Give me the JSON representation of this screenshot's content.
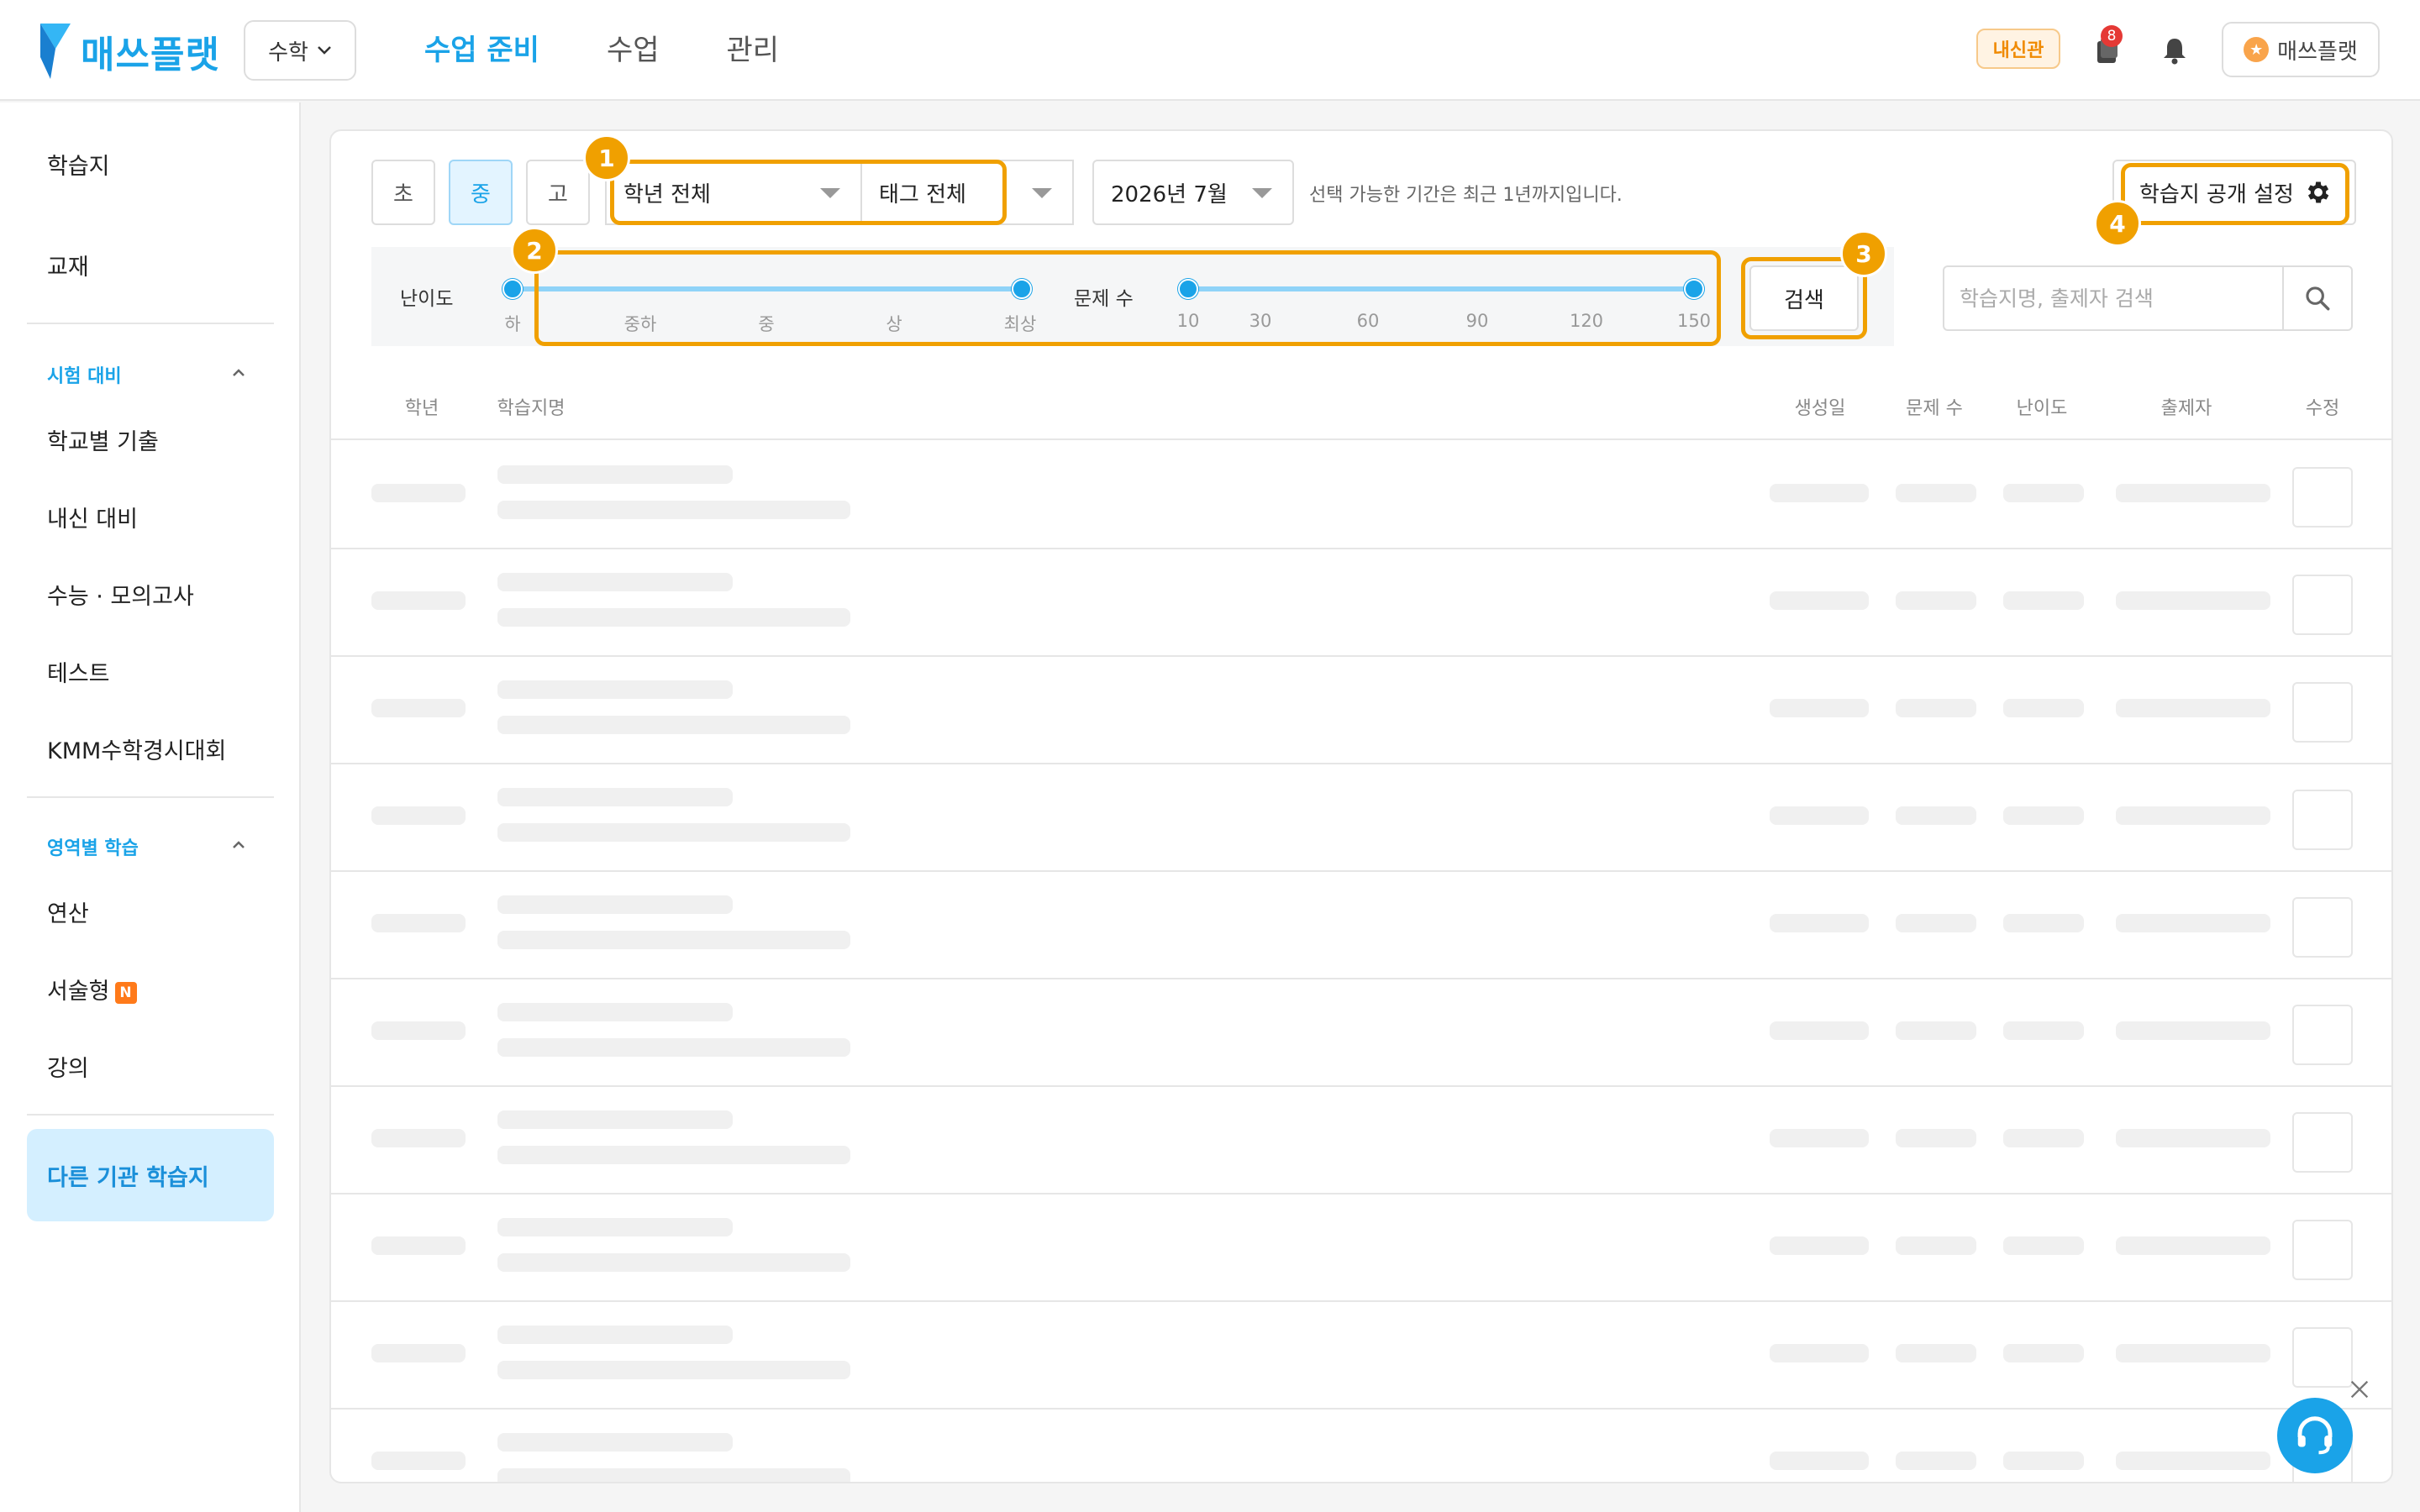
{
  "header": {
    "logo_text": "매쓰플랫",
    "subject": "수학",
    "nav": [
      "수업 준비",
      "수업",
      "관리"
    ],
    "nav_active": 0,
    "badge": "내신관",
    "notification_count": "8",
    "profile_label": "매쓰플랫"
  },
  "sidebar": {
    "top_items": [
      "학습지",
      "교재"
    ],
    "section1": {
      "title": "시험 대비",
      "items": [
        "학교별 기출",
        "내신 대비",
        "수능 · 모의고사",
        "테스트",
        "KMM수학경시대회"
      ]
    },
    "section2": {
      "title": "영역별 학습",
      "items": [
        "연산",
        "서술형",
        "강의"
      ],
      "new_badge": "N"
    },
    "cta": "다른 기관 학습지"
  },
  "toolbar": {
    "levels": [
      "초",
      "중",
      "고"
    ],
    "active_level": "중",
    "grade_select": "학년 전체",
    "tag_select": "태그 전체",
    "date_select": "2026년 7월",
    "hint": "선택 가능한 기간은 최근 1년까지입니다.",
    "publish_settings": "학습지 공개 설정"
  },
  "filters": {
    "difficulty_label": "난이도",
    "difficulty_ticks": [
      "하",
      "중하",
      "중",
      "상",
      "최상"
    ],
    "difficulty_range": [
      "하",
      "최상"
    ],
    "count_label": "문제 수",
    "count_ticks": [
      "10",
      "30",
      "60",
      "90",
      "120",
      "150"
    ],
    "count_range": [
      10,
      150
    ],
    "search_button": "검색",
    "search_placeholder": "학습지명, 출제자 검색"
  },
  "annotations": [
    "1",
    "2",
    "3",
    "4"
  ],
  "table": {
    "columns": [
      "학년",
      "학습지명",
      "생성일",
      "문제 수",
      "난이도",
      "출제자",
      "수정"
    ]
  },
  "colors": {
    "accent": "#1aa3e8",
    "annotation": "#f0a000",
    "cta_bg": "#d4efff"
  }
}
